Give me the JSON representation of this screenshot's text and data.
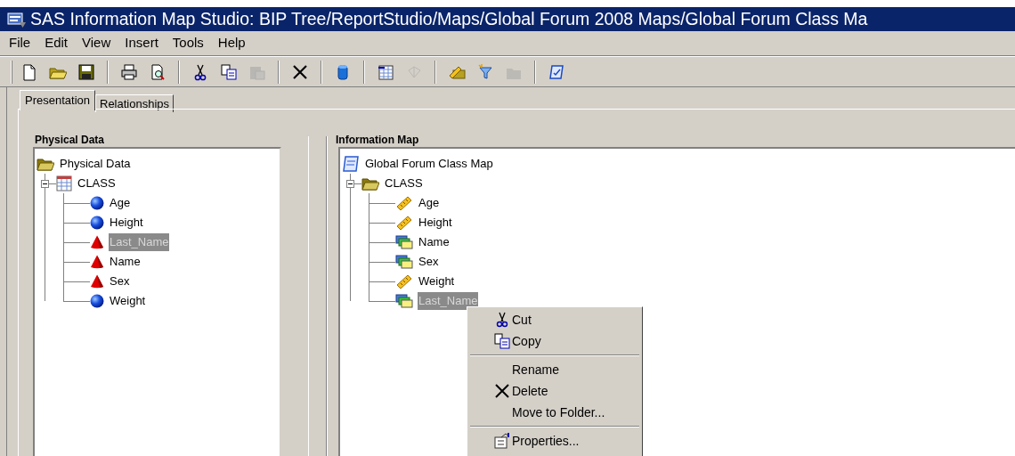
{
  "window": {
    "title": "SAS Information Map Studio: BIP Tree/ReportStudio/Maps/Global Forum 2008 Maps/Global Forum Class Ma"
  },
  "menu": [
    "File",
    "Edit",
    "View",
    "Insert",
    "Tools",
    "Help"
  ],
  "toolbar": [
    [
      {
        "kind": "new",
        "disabled": false
      },
      {
        "kind": "open",
        "disabled": false
      },
      {
        "kind": "save",
        "disabled": false
      }
    ],
    [
      {
        "kind": "print",
        "disabled": false
      },
      {
        "kind": "preview",
        "disabled": false
      }
    ],
    [
      {
        "kind": "cut",
        "disabled": false
      },
      {
        "kind": "copy",
        "disabled": false
      },
      {
        "kind": "paste",
        "disabled": true
      }
    ],
    [
      {
        "kind": "delete",
        "disabled": false
      }
    ],
    [
      {
        "kind": "cylinder",
        "disabled": false
      }
    ],
    [
      {
        "kind": "grid",
        "disabled": false
      },
      {
        "kind": "wand",
        "disabled": true
      }
    ],
    [
      {
        "kind": "ruler",
        "disabled": false
      },
      {
        "kind": "filter",
        "disabled": false
      },
      {
        "kind": "folder",
        "disabled": true
      }
    ],
    [
      {
        "kind": "map",
        "disabled": false
      }
    ]
  ],
  "tabs": [
    {
      "label": "Presentation",
      "selected": true
    },
    {
      "label": "Relationships",
      "selected": false
    }
  ],
  "physical_data": {
    "title": "Physical Data",
    "tree": {
      "label": "Physical Data",
      "kind": "folder",
      "selected": false,
      "children": [
        {
          "label": "CLASS",
          "kind": "table",
          "selected": false,
          "expanded": true,
          "children": [
            {
              "label": "Age",
              "kind": "numeric",
              "selected": false
            },
            {
              "label": "Height",
              "kind": "numeric",
              "selected": false
            },
            {
              "label": "Last_Name",
              "kind": "character",
              "selected": true
            },
            {
              "label": "Name",
              "kind": "character",
              "selected": false
            },
            {
              "label": "Sex",
              "kind": "character",
              "selected": false
            },
            {
              "label": "Weight",
              "kind": "numeric",
              "selected": false
            }
          ]
        }
      ]
    }
  },
  "information_map": {
    "title": "Information Map",
    "tree": {
      "label": "Global Forum Class Map",
      "kind": "map",
      "selected": false,
      "children": [
        {
          "label": "CLASS",
          "kind": "folder",
          "selected": false,
          "expanded": true,
          "children": [
            {
              "label": "Age",
              "kind": "measure",
              "selected": false
            },
            {
              "label": "Height",
              "kind": "measure",
              "selected": false
            },
            {
              "label": "Name",
              "kind": "category",
              "selected": false
            },
            {
              "label": "Sex",
              "kind": "category",
              "selected": false
            },
            {
              "label": "Weight",
              "kind": "measure",
              "selected": false
            },
            {
              "label": "Last_Name",
              "kind": "category",
              "selected": true
            }
          ]
        }
      ]
    }
  },
  "context_menu": [
    [
      {
        "label": "Cut",
        "kind": "cut"
      },
      {
        "label": "Copy",
        "kind": "copy"
      }
    ],
    [
      {
        "label": "Rename",
        "kind": "none"
      },
      {
        "label": "Delete",
        "kind": "delete"
      },
      {
        "label": "Move to Folder...",
        "kind": "none"
      }
    ],
    [
      {
        "label": "Properties...",
        "kind": "properties"
      }
    ]
  ]
}
